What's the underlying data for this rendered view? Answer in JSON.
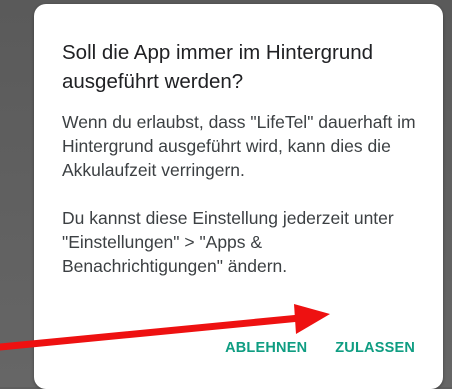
{
  "dialog": {
    "title": "Soll die App immer im Hintergrund ausgeführt werden?",
    "paragraph1": "Wenn du erlaubst, dass \"LifeTel\" dauerhaft im Hintergrund ausgeführt wird, kann dies die  Akkulaufzeit verringern.",
    "paragraph2": "Du kannst diese Einstellung jederzeit unter \"Einstellungen\" > \"Apps & Benachrichtigungen\" ändern.",
    "actions": {
      "deny": "ABLEHNEN",
      "allow": "ZULASSEN"
    }
  },
  "annotation": {
    "arrow_icon": "red-arrow-icon",
    "arrow_color": "#ee1111"
  },
  "colors": {
    "accent": "#0f9d82",
    "title": "#202124",
    "body": "#3c4043",
    "scrim": "#5f5f5f"
  }
}
